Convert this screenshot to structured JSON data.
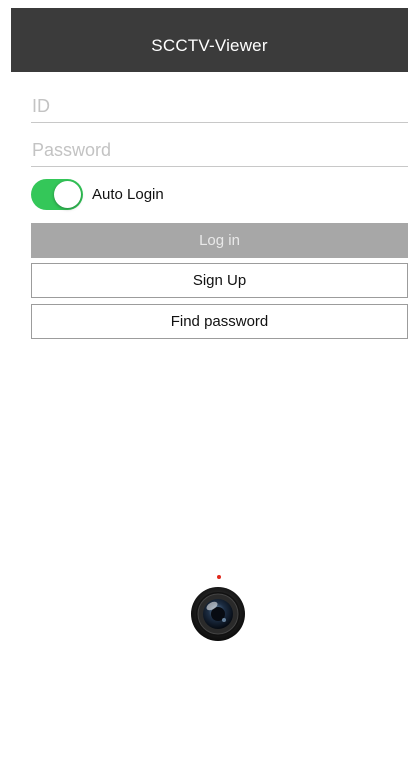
{
  "navbar": {
    "title": "SCCTV-Viewer"
  },
  "form": {
    "id_placeholder": "ID",
    "id_value": "",
    "password_placeholder": "Password",
    "password_value": ""
  },
  "auto_login": {
    "label": "Auto Login",
    "on": true
  },
  "buttons": {
    "login": "Log in",
    "signup": "Sign Up",
    "find_password": "Find password"
  },
  "colors": {
    "navbar_bg": "#3b3b3b",
    "toggle_on": "#34c759",
    "login_bg": "#a7a7a7",
    "record_dot": "#e0281c"
  },
  "icons": {
    "camera": "camera-lens-icon",
    "indicator": "record-indicator-icon"
  }
}
